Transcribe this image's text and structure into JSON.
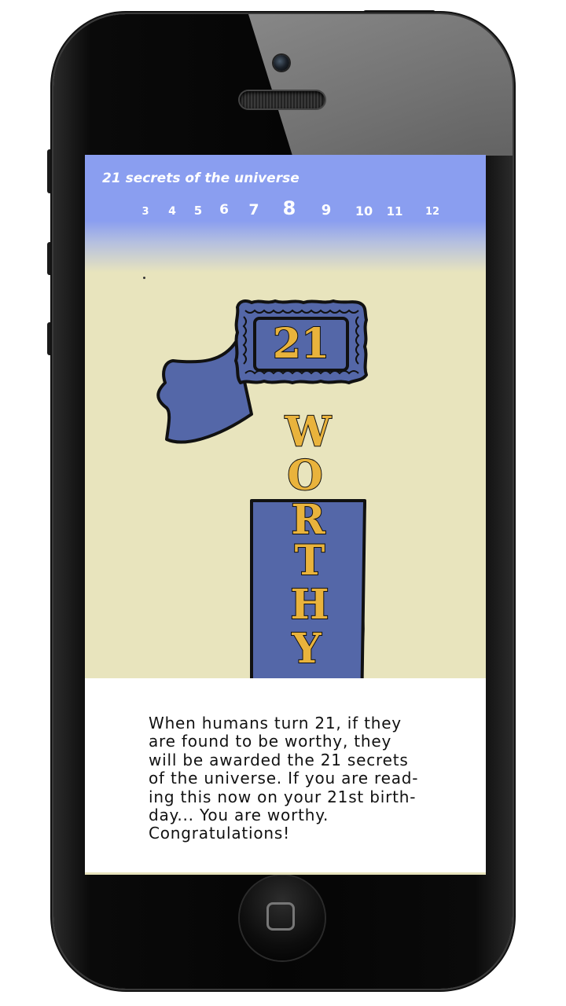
{
  "app": {
    "title": "21 secrets of the universe"
  },
  "pager": {
    "items": [
      {
        "label": "3",
        "selected": false
      },
      {
        "label": "4",
        "selected": false
      },
      {
        "label": "5",
        "selected": false
      },
      {
        "label": "6",
        "selected": false
      },
      {
        "label": "7",
        "selected": false
      },
      {
        "label": "8",
        "selected": true
      },
      {
        "label": "9",
        "selected": false
      },
      {
        "label": "10",
        "selected": false
      },
      {
        "label": "11",
        "selected": false
      },
      {
        "label": "12",
        "selected": false
      }
    ]
  },
  "illustration": {
    "badge_number": "21",
    "ribbon_letters": [
      "W",
      "O",
      "R",
      "T",
      "H",
      "Y"
    ],
    "icon": "ribbon-award-icon"
  },
  "content": {
    "lines": [
      "When humans turn 21, if they",
      "are found to be worthy, they",
      "will be awarded the 21 secrets",
      "of the universe. If you are read-",
      "ing this now on your 21st birth-",
      "day... You are worthy.",
      "Congratulations!"
    ]
  },
  "colors": {
    "header_blue": "#8a9ef0",
    "background_cream": "#e8e4bd",
    "ribbon_blue": "#5467a8",
    "letter_gold": "#e9b33c",
    "outline": "#111111"
  }
}
